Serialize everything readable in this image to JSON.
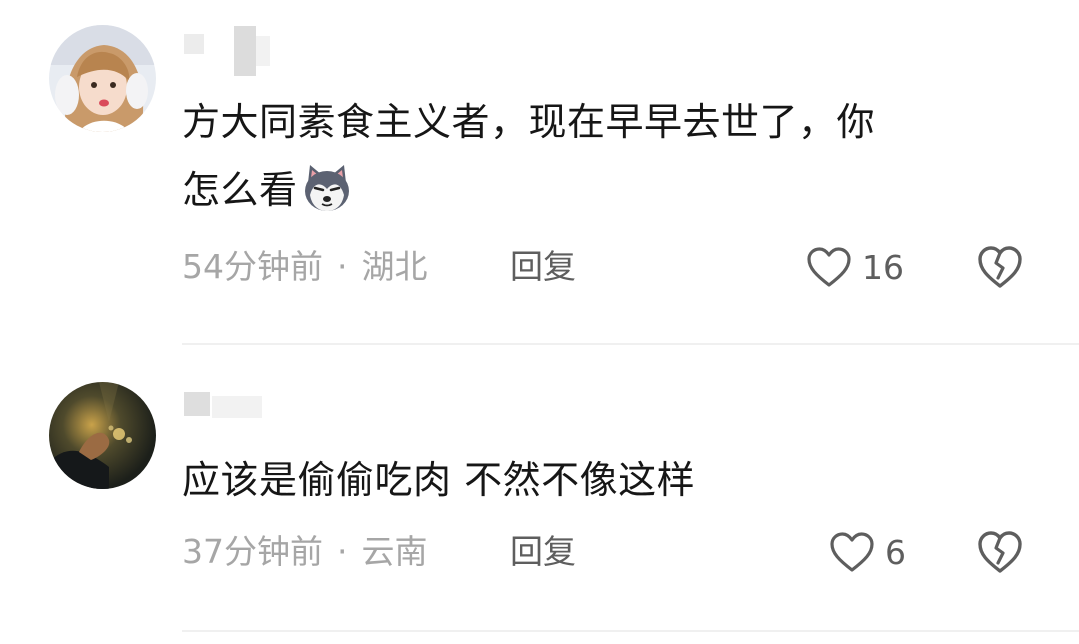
{
  "comments": [
    {
      "username": "",
      "text_line1": "方大同素食主义者，现在早早去世了，你",
      "text_line2": "怎么看",
      "emoji": "husky-emoji-icon",
      "time": "54分钟前",
      "separator": "·",
      "location": "湖北",
      "reply_label": "回复",
      "likes": "16"
    },
    {
      "username": "",
      "text_line1": "应该是偷偷吃肉  不然不像这样",
      "time": "37分钟前",
      "separator": "·",
      "location": "云南",
      "reply_label": "回复",
      "likes": "6"
    }
  ],
  "colors": {
    "text": "#161616",
    "meta": "#a6a6a6",
    "action": "#5e5e5e",
    "divider": "#f0f0f0"
  }
}
